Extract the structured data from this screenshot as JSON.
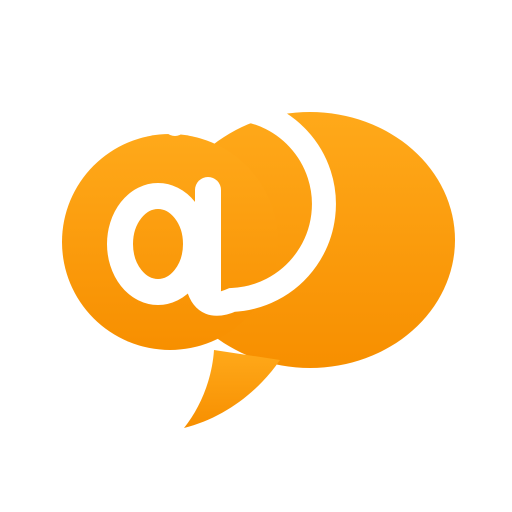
{
  "icon": {
    "name": "email-chat-bubble-icon",
    "glyph": "@",
    "colors": {
      "bubble_top": "#FFA91A",
      "bubble_bottom": "#F78F00",
      "glyph": "#FFFFFF",
      "background": "#FFFFFF"
    }
  }
}
